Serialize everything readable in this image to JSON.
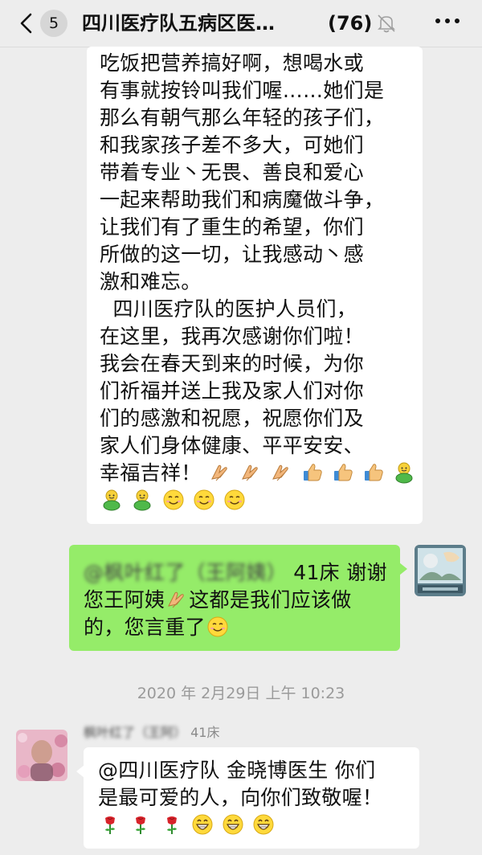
{
  "header": {
    "back_badge": "5",
    "title": "四川医疗队五病区医…",
    "member_count": "(76)"
  },
  "messages": [
    {
      "id": "msg1",
      "lines": [
        "吃饭把营养搞好啊，想喝水或",
        "有事就按铃叫我们喔……她们是",
        "那么有朝气那么年轻的孩子们，",
        "和我家孩子差不多大，可她们",
        "带着专业丶无畏、善良和爱心",
        "一起来帮助我们和病魔做斗争，",
        "让我们有了重生的希望，你们",
        "所做的这一切，让我感动丶感",
        "激和难忘。",
        "  四川医疗队的医护人员们，",
        "在这里，我再次感谢你们啦！",
        "我会在春天到来的时候，为你",
        "们祈福并送上我及家人们对你",
        "们的感激和祝愿，祝愿你们及",
        "家人们身体健康、平平安安、",
        "幸福吉祥！"
      ]
    },
    {
      "id": "msg2",
      "mention_blurred": "@枫叶红了（王阿姨）",
      "line1_rest": " 41床 谢谢",
      "line2": "您王阿姨",
      "line2_rest": "这都是我们应该做",
      "line3": "的，您言重了"
    },
    {
      "id": "msg3",
      "line1": "@四川医疗队 金晓博医生 你们",
      "line2": "是最可爱的人，向你们致敬喔！"
    }
  ],
  "timestamp": "2020 年 2月29日 上午 10:23",
  "sender": {
    "name_blurred": "枫叶红了（王阿）",
    "suffix": " 41床"
  },
  "icons": {
    "back": "chevron-left-icon",
    "mute": "bell-slash-icon",
    "more": "more-dots-icon",
    "pray": "pray-emoji-icon",
    "thumbs": "thumbs-up-emoji-icon",
    "strong": "strong-emoji-icon",
    "smile": "smile-emoji-icon",
    "rose": "rose-emoji-icon",
    "grin": "grin-emoji-icon"
  },
  "colors": {
    "background": "#ededed",
    "bubble_self": "#95ec69",
    "bubble_other": "#ffffff"
  }
}
